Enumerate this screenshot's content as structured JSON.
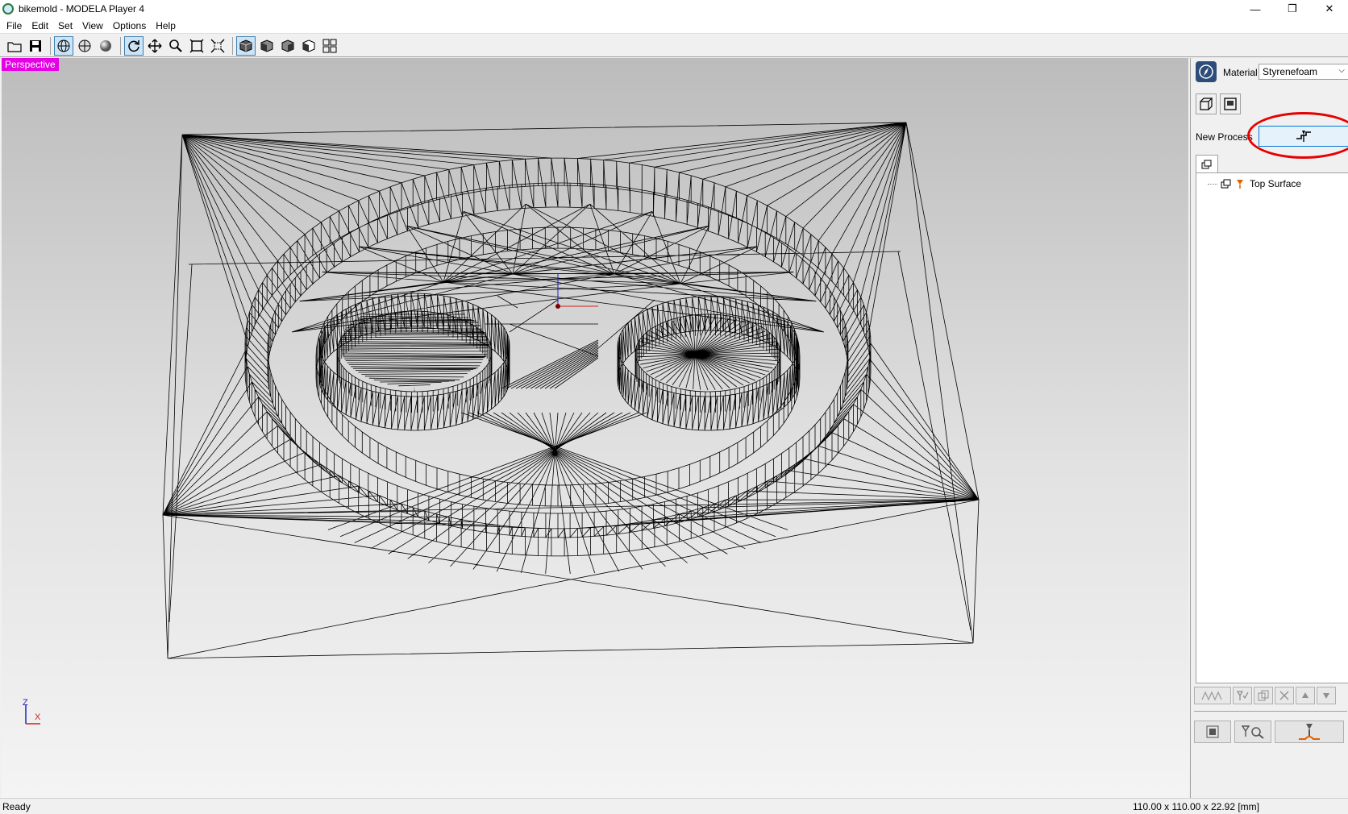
{
  "window": {
    "title": "bikemold - MODELA Player 4",
    "minimize": "—",
    "restore": "❐",
    "close": "✕"
  },
  "menu": [
    {
      "label": "File"
    },
    {
      "label": "Edit"
    },
    {
      "label": "Set"
    },
    {
      "label": "View"
    },
    {
      "label": "Options"
    },
    {
      "label": "Help"
    }
  ],
  "toolbar": {
    "buttons": [
      {
        "icon": "open-folder-icon"
      },
      {
        "icon": "save-icon"
      },
      {
        "icon": "wireframe-view-icon",
        "active": true
      },
      {
        "icon": "surface-view-icon"
      },
      {
        "icon": "render-view-icon"
      },
      {
        "icon": "rotate-icon",
        "active": true
      },
      {
        "icon": "pan-icon"
      },
      {
        "icon": "zoom-icon"
      },
      {
        "icon": "fit-icon"
      },
      {
        "icon": "zoom-extents-icon"
      },
      {
        "icon": "iso-view-icon",
        "active": true
      },
      {
        "icon": "front-view-icon"
      },
      {
        "icon": "right-view-icon"
      },
      {
        "icon": "left-view-icon"
      },
      {
        "icon": "multi-view-icon"
      }
    ]
  },
  "viewport": {
    "mode_label": "Perspective",
    "axis_z": "Z",
    "axis_x": "X"
  },
  "panel": {
    "material_label": "Material",
    "material_value": "Styrenefoam",
    "new_process_label": "New Process",
    "tree": [
      {
        "label": "Top Surface"
      }
    ]
  },
  "status": {
    "left": "Ready",
    "right": "110.00 x 110.00 x 22.92 [mm]"
  },
  "colors": {
    "highlight": "#e600e6",
    "annotation_circle": "#e60000",
    "accent": "#0078d7"
  }
}
